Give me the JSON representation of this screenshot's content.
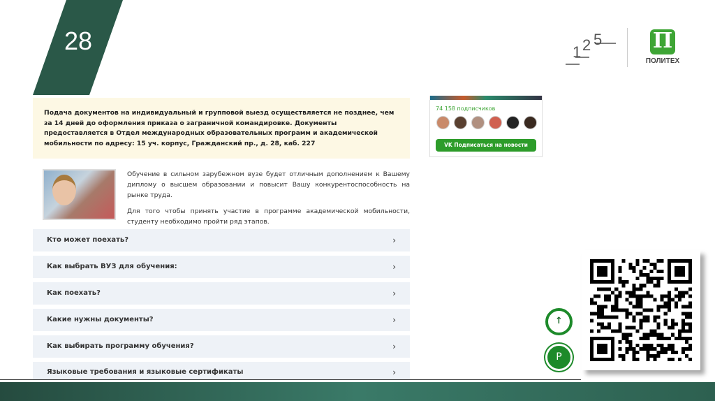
{
  "slide": {
    "number": "28"
  },
  "logos": {
    "anniversary": "125",
    "brand": "ПОЛИТЕХ",
    "brand_mark": "П"
  },
  "notice": {
    "text": "Подача документов на индивидуальный и групповой выезд осуществляется не позднее, чем за 14 дней до оформления приказа о заграничной командировке. Документы предоставляется в Отдел международных образовательных программ и академической мобильности по адресу: 15 уч. корпус, Гражданский пр., д. 28, каб. 227"
  },
  "intro": {
    "p1": "Обучение в сильном зарубежном вузе будет отличным дополнением к Вашему диплому о высшем образовании и повысит Вашу конкурентоспособность на рынке труда.",
    "p2": "Для того чтобы принять участие в программе академической мобильности, студенту необходимо пройти ряд этапов."
  },
  "accordion": [
    {
      "label": "Кто может поехать?"
    },
    {
      "label": "Как выбрать ВУЗ для обучения:"
    },
    {
      "label": "Как поехать?"
    },
    {
      "label": "Какие нужны документы?"
    },
    {
      "label": "Как выбирать программу обучения?"
    },
    {
      "label": "Языковые требования и языковые сертификаты"
    }
  ],
  "chevron": "›",
  "vk_widget": {
    "subscribers": "74 158 подписчиков",
    "button": "VK  Подписаться на новости"
  },
  "icons": {
    "up": "↑",
    "help": "P"
  },
  "colors": {
    "green": "#3ea535",
    "dark_green": "#2c5a50"
  }
}
